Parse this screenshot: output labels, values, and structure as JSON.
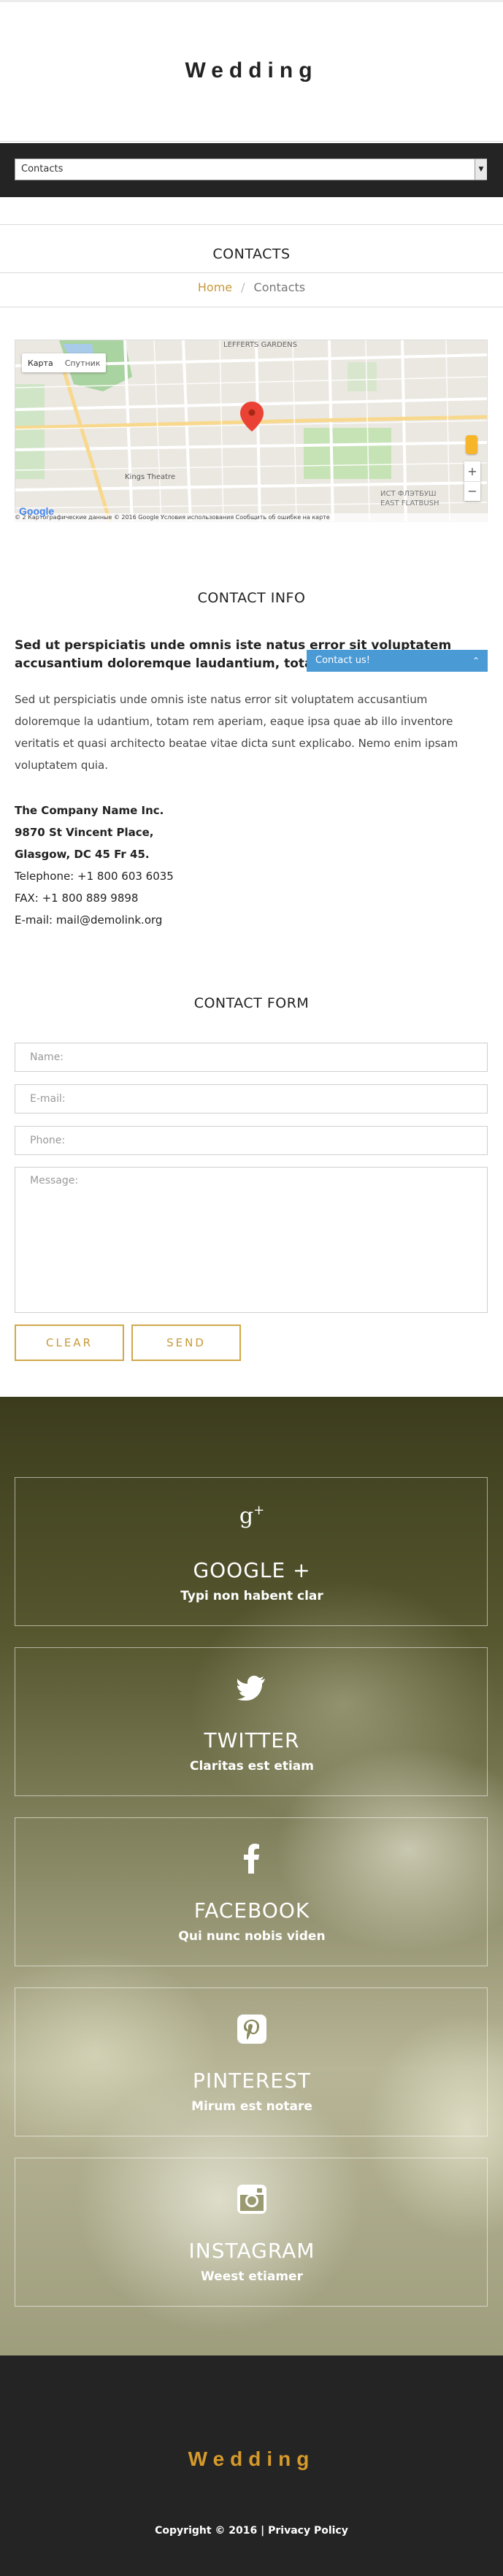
{
  "site": {
    "logo": "Wedding"
  },
  "nav": {
    "selected": "Contacts"
  },
  "page": {
    "title": "CONTACTS"
  },
  "breadcrumb": {
    "home": "Home",
    "separator": "/",
    "current": "Contacts"
  },
  "map": {
    "type_map": "Карта",
    "type_satellite": "Спутник",
    "zoom_in": "+",
    "zoom_out": "−",
    "google": "Google",
    "footer": "© 2  Картографические данные © 2016 Google    Условия использования    Сообщить об ошибке на карте",
    "labels": [
      "LEFFERTS GARDENS",
      "Kings Theatre",
      "ИСТ ФЛЭТБУШ",
      "EAST FLATBUSH"
    ]
  },
  "contact_info": {
    "heading": "CONTACT INFO",
    "lead": "Sed ut perspiciatis unde omnis iste natus error sit voluptatem accusantium doloremque laudantium, totam rem aperiam.",
    "body": "Sed ut perspiciatis unde omnis iste natus error sit voluptatem accusantium doloremque la udantium, totam rem aperiam, eaque ipsa quae ab illo inventore veritatis et quasi architecto beatae vitae dicta sunt explicabo. Nemo enim ipsam voluptatem quia.",
    "company": "The Company Name Inc.",
    "street": "9870 St Vincent Place,",
    "city": "Glasgow, DC 45 Fr 45.",
    "telephone": "Telephone: +1 800 603 6035",
    "fax": "FAX: +1 800 889 9898",
    "email": "E-mail: mail@demolink.org"
  },
  "contact_widget": {
    "label": "Contact us!",
    "chevron": "⌃"
  },
  "form": {
    "heading": "CONTACT FORM",
    "name_placeholder": "Name:",
    "email_placeholder": "E-mail:",
    "phone_placeholder": "Phone:",
    "message_placeholder": "Message:",
    "clear_label": "CLEAR",
    "send_label": "SEND"
  },
  "social": [
    {
      "icon": "google-plus-icon",
      "glyph": "g+",
      "title": "GOOGLE +",
      "sub": "Typi non habent clar"
    },
    {
      "icon": "twitter-icon",
      "glyph": "twitter",
      "title": "TWITTER",
      "sub": "Claritas est etiam"
    },
    {
      "icon": "facebook-icon",
      "glyph": "f",
      "title": "FACEBOOK",
      "sub": "Qui nunc nobis viden"
    },
    {
      "icon": "pinterest-icon",
      "glyph": "p",
      "title": "PINTEREST",
      "sub": "Mirum est notare"
    },
    {
      "icon": "instagram-icon",
      "glyph": "camera",
      "title": "INSTAGRAM",
      "sub": "Weest etiamer"
    }
  ],
  "footer": {
    "logo": "Wedding",
    "copyright": "Copyright © 2016 | Privacy Policy"
  },
  "colors": {
    "accent": "#c79a3b",
    "dark": "#242424",
    "widget": "#4a9ad6"
  }
}
